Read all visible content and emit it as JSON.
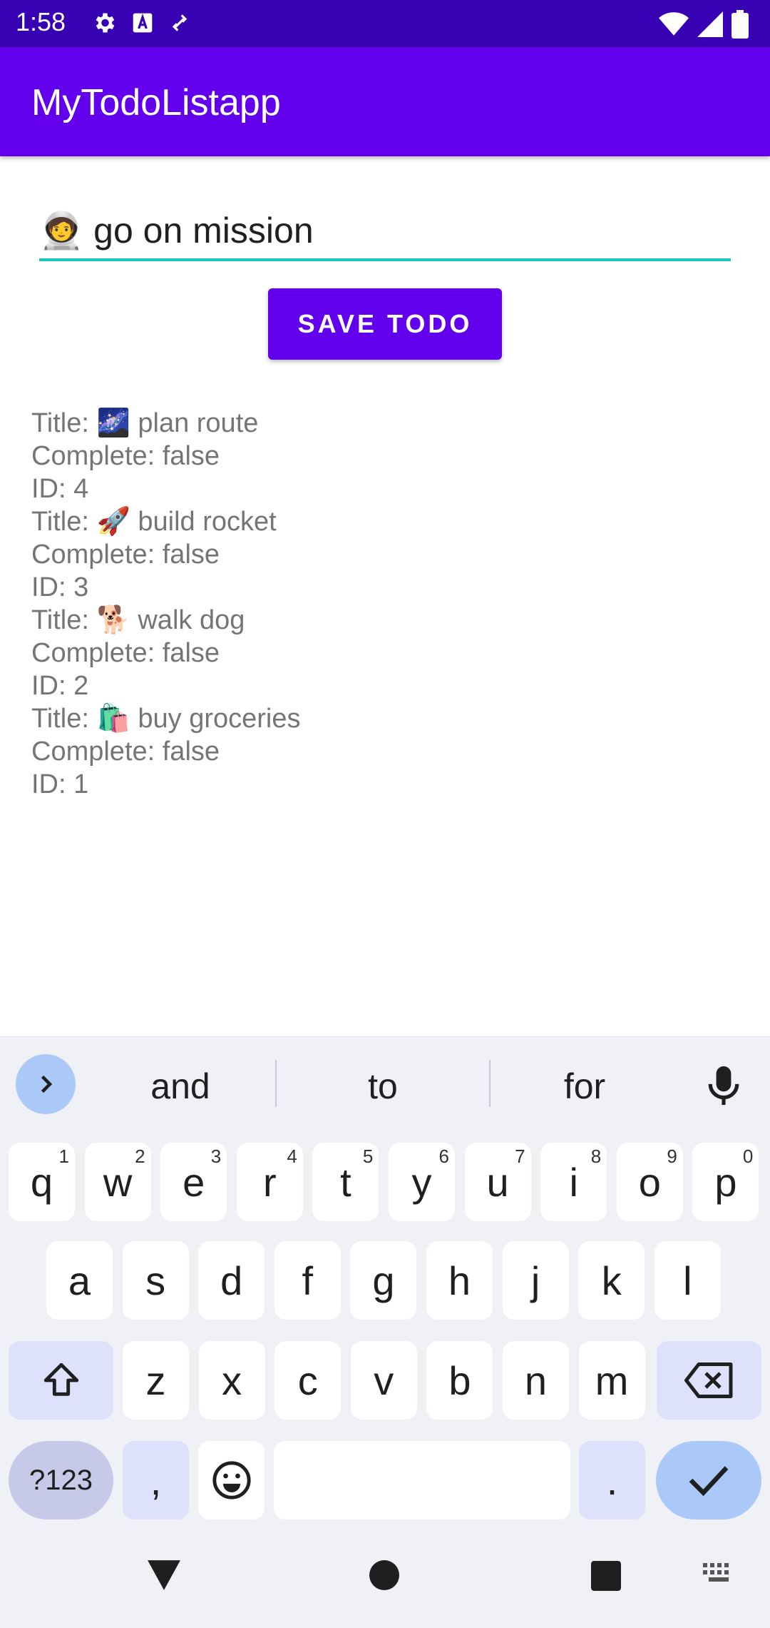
{
  "status_bar": {
    "time": "1:58",
    "left_icons": [
      "settings-icon",
      "text-a-icon",
      "link-off-icon"
    ],
    "right_icons": [
      "wifi-icon",
      "signal-icon",
      "battery-icon"
    ],
    "background": "#3700b3"
  },
  "app_bar": {
    "title": "MyTodoListapp",
    "background": "#6200ee"
  },
  "todo_form": {
    "input_value": "🧑‍🚀 go on mission",
    "save_label": "SAVE TODO",
    "accent": "#1ec8b8"
  },
  "todos": [
    {
      "title_line": "Title: 🌌 plan route",
      "complete_line": "Complete: false",
      "id_line": "ID: 4"
    },
    {
      "title_line": "Title: 🚀 build rocket",
      "complete_line": "Complete: false",
      "id_line": "ID: 3"
    },
    {
      "title_line": "Title: 🐕 walk dog",
      "complete_line": "Complete: false",
      "id_line": "ID: 2"
    },
    {
      "title_line": "Title: 🛍️ buy groceries",
      "complete_line": "Complete: false",
      "id_line": "ID: 1"
    }
  ],
  "keyboard": {
    "suggestions": [
      "and",
      "to",
      "for"
    ],
    "row1": [
      {
        "k": "q",
        "h": "1"
      },
      {
        "k": "w",
        "h": "2"
      },
      {
        "k": "e",
        "h": "3"
      },
      {
        "k": "r",
        "h": "4"
      },
      {
        "k": "t",
        "h": "5"
      },
      {
        "k": "y",
        "h": "6"
      },
      {
        "k": "u",
        "h": "7"
      },
      {
        "k": "i",
        "h": "8"
      },
      {
        "k": "o",
        "h": "9"
      },
      {
        "k": "p",
        "h": "0"
      }
    ],
    "row2": [
      "a",
      "s",
      "d",
      "f",
      "g",
      "h",
      "j",
      "k",
      "l"
    ],
    "row3": [
      "z",
      "x",
      "c",
      "v",
      "b",
      "n",
      "m"
    ],
    "symbols_label": "?123",
    "comma_label": ",",
    "period_label": "."
  }
}
